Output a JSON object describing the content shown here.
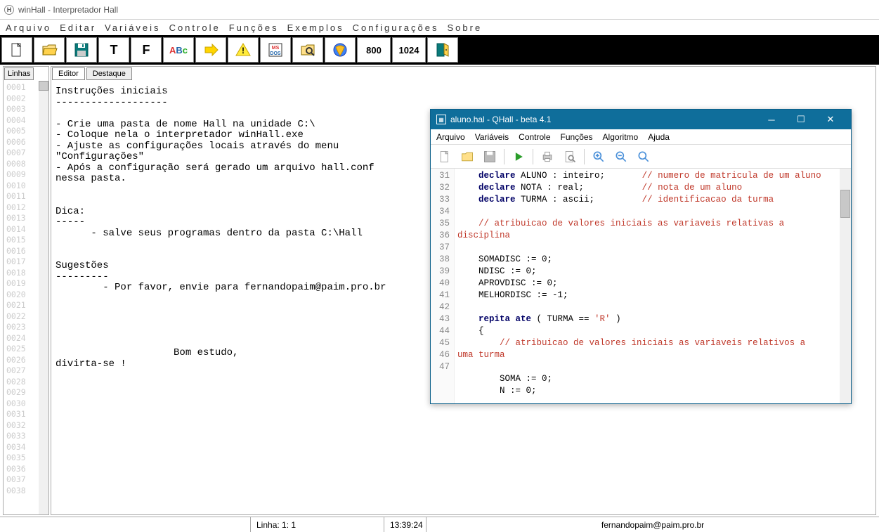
{
  "titlebar": {
    "app": "winHall",
    "doc": "Interpretador Hall"
  },
  "menubar": [
    "Arquivo",
    "Editar",
    "Variáveis",
    "Controle",
    "Funções",
    "Exemplos",
    "Configurações",
    "Sobre"
  ],
  "toolbar": {
    "t_label": "T",
    "f_label": "F",
    "abc_label": "ABc",
    "res1": "800",
    "res2": "1024"
  },
  "left_tab": "Linhas",
  "line_numbers": [
    "0001",
    "0002",
    "0003",
    "0004",
    "0005",
    "0006",
    "0007",
    "0008",
    "0009",
    "0010",
    "0011",
    "0012",
    "0013",
    "0014",
    "0015",
    "0016",
    "0017",
    "0018",
    "0019",
    "0020",
    "0021",
    "0022",
    "0023",
    "0024",
    "0025",
    "0026",
    "0027",
    "0028",
    "0029",
    "0030",
    "0031",
    "0032",
    "0033",
    "0034",
    "0035",
    "0036",
    "0037",
    "0038"
  ],
  "editor_tabs": {
    "active": "Editor",
    "inactive": "Destaque"
  },
  "editor_text": "Instruções iniciais\n-------------------\n\n- Crie uma pasta de nome Hall na unidade C:\\\n- Coloque nela o interpretador winHall.exe\n- Ajuste as configurações locais através do menu \n\"Configurações\"\n- Após a configuração será gerado um arquivo hall.conf \nnessa pasta.\n\n\nDica:\n-----\n      - salve seus programas dentro da pasta C:\\Hall\n\n\nSugestões\n---------\n        - Por favor, envie para fernandopaim@paim.pro.br\n\n\n\n\n\n                    Bom estudo,\ndivirta-se !",
  "child": {
    "title": "aluno.hal - QHall - beta 4.1",
    "menu": [
      "Arquivo",
      "Variáveis",
      "Controle",
      "Funções",
      "Algoritmo",
      "Ajuda"
    ],
    "first_line_no": 31,
    "lines": [
      {
        "n": 31,
        "pre": "    ",
        "kw": "declare",
        "mid": " ALUNO : inteiro;       ",
        "cm": "// numero de matricula de um aluno"
      },
      {
        "n": 32,
        "pre": "    ",
        "kw": "declare",
        "mid": " NOTA : real;           ",
        "cm": "// nota de um aluno"
      },
      {
        "n": 33,
        "pre": "    ",
        "kw": "declare",
        "mid": " TURMA : ascii;         ",
        "cm": "// identificacao da turma"
      },
      {
        "n": 34,
        "pre": "",
        "kw": "",
        "mid": "",
        "cm": ""
      },
      {
        "n": 35,
        "pre": "    ",
        "kw": "",
        "mid": "",
        "cm": "// atribuicao de valores iniciais as variaveis relativas a"
      },
      {
        "n": "",
        "pre": "",
        "kw": "",
        "mid": "",
        "cm": "disciplina"
      },
      {
        "n": 36,
        "pre": "",
        "kw": "",
        "mid": "",
        "cm": ""
      },
      {
        "n": 37,
        "pre": "    SOMADISC := 0;",
        "kw": "",
        "mid": "",
        "cm": ""
      },
      {
        "n": 38,
        "pre": "    NDISC := 0;",
        "kw": "",
        "mid": "",
        "cm": ""
      },
      {
        "n": 39,
        "pre": "    APROVDISC := 0;",
        "kw": "",
        "mid": "",
        "cm": ""
      },
      {
        "n": 40,
        "pre": "    MELHORDISC := -1;",
        "kw": "",
        "mid": "",
        "cm": ""
      },
      {
        "n": 41,
        "pre": "",
        "kw": "",
        "mid": "",
        "cm": ""
      },
      {
        "n": 42,
        "pre": "    ",
        "kw": "repita ate",
        "mid": " ( TURMA == ",
        "str": "'R'",
        "mid2": " )",
        "cm": ""
      },
      {
        "n": 43,
        "pre": "    {",
        "kw": "",
        "mid": "",
        "cm": ""
      },
      {
        "n": 44,
        "pre": "        ",
        "kw": "",
        "mid": "",
        "cm": "// atribuicao de valores iniciais as variaveis relativos a"
      },
      {
        "n": "",
        "pre": "",
        "kw": "",
        "mid": "",
        "cm": "uma turma"
      },
      {
        "n": 45,
        "pre": "",
        "kw": "",
        "mid": "",
        "cm": ""
      },
      {
        "n": 46,
        "pre": "        SOMA := 0;",
        "kw": "",
        "mid": "",
        "cm": ""
      },
      {
        "n": 47,
        "pre": "        N := 0;",
        "kw": "",
        "mid": "",
        "cm": ""
      }
    ]
  },
  "status": {
    "pos": "Linha: 1: 1",
    "time": "13:39:24",
    "email": "fernandopaim@paim.pro.br"
  }
}
